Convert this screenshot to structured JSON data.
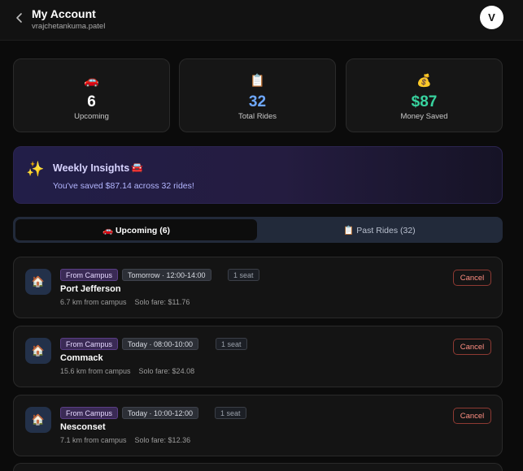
{
  "header": {
    "title": "My Account",
    "username": "vrajchetankuma.patel",
    "avatar_letter": "V"
  },
  "stats": [
    {
      "icon": "🚗",
      "value": "6",
      "label": "Upcoming",
      "color": "#ffffff"
    },
    {
      "icon": "📋",
      "value": "32",
      "label": "Total Rides",
      "color": "#6ea8ff"
    },
    {
      "icon": "💰",
      "value": "$87",
      "label": "Money Saved",
      "color": "#38d39f"
    }
  ],
  "insights": {
    "icon": "✨",
    "title": "Weekly Insights",
    "title_emoji": "�under",
    "text": "You've saved $87.14 across 32 rides!"
  },
  "tabs": {
    "upcoming": "🚗 Upcoming (6)",
    "past": "📋 Past Rides (32)"
  },
  "rides": [
    {
      "icon": "🏠",
      "direction": "From Campus",
      "time": "Tomorrow · 12:00-14:00",
      "seats": "1 seat",
      "name": "Port Jefferson",
      "distance": "6.7 km from campus",
      "fare": "Solo fare: $11.76",
      "action": "Cancel"
    },
    {
      "icon": "🏠",
      "direction": "From Campus",
      "time": "Today · 08:00-10:00",
      "seats": "1 seat",
      "name": "Commack",
      "distance": "15.6 km from campus",
      "fare": "Solo fare: $24.08",
      "action": "Cancel"
    },
    {
      "icon": "🏠",
      "direction": "From Campus",
      "time": "Today · 10:00-12:00",
      "seats": "1 seat",
      "name": "Nesconset",
      "distance": "7.1 km from campus",
      "fare": "Solo fare: $12.36",
      "action": "Cancel"
    }
  ],
  "colors": {
    "accent_purple": "#3a2a55",
    "cancel_red": "#ff8f82",
    "total_rides_blue": "#6ea8ff",
    "money_green": "#38d39f"
  }
}
